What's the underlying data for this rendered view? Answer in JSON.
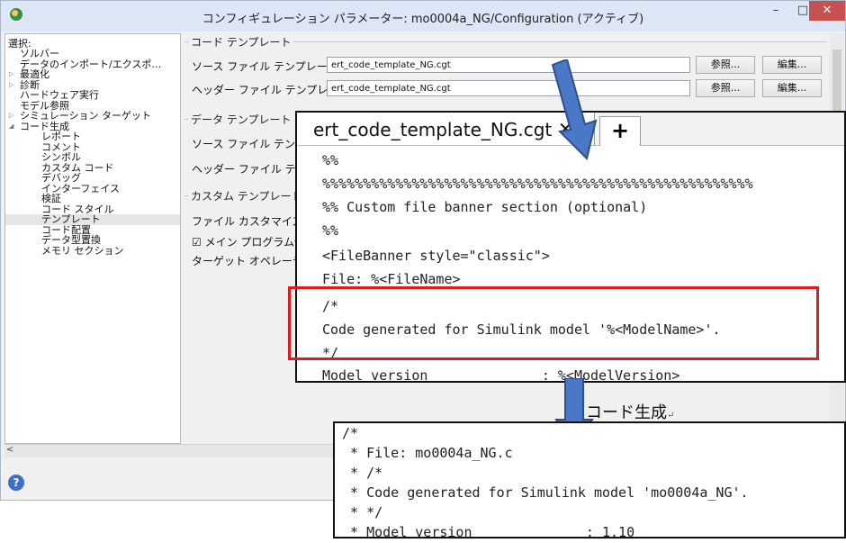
{
  "window": {
    "title": "コンフィギュレーション パラメーター: mo0004a_NG/Configuration (アクティブ)",
    "minimize": "–",
    "maximize": "□",
    "close": "✕"
  },
  "tree": {
    "header": "選択:",
    "items": [
      "ソルバー",
      "データのインポート/エクスポ…",
      "最適化",
      "診断",
      "ハードウェア実行",
      "モデル参照",
      "シミュレーション ターゲット",
      "コード生成",
      "レポート",
      "コメント",
      "シンボル",
      "カスタム コード",
      "デバッグ",
      "インターフェイス",
      "検証",
      "コード スタイル",
      "テンプレート",
      "コード配置",
      "データ型置換",
      "メモリ セクション"
    ]
  },
  "panel": {
    "code_template_section": "コード テンプレート",
    "source_template_label": "ソース ファイル テンプレート:",
    "source_template_value": "ert_code_template_NG.cgt",
    "header_template_label": "ヘッダー ファイル テンプレート:",
    "header_template_value": "ert_code_template_NG.cgt",
    "browse_label": "参照...",
    "edit_label": "編集...",
    "data_template_section": "データ テンプレート",
    "data_source_label": "ソース ファイル テンプレ",
    "data_header_label": "ヘッダー ファイル テンプレ",
    "custom_template_section": "カスタム テンプレート",
    "file_customize_label": "ファイル カスタマイズ テン",
    "main_program_label": "☑ メイン プログラム例の",
    "target_os_label": "ターゲット オペレーティン"
  },
  "editor": {
    "tab_title": "ert_code_template_NG.cgt",
    "tab_close": "✕",
    "tab_plus": "+",
    "lines": [
      "%%",
      "%%%%%%%%%%%%%%%%%%%%%%%%%%%%%%%%%%%%%%%%%%%%%%%%%%%%%",
      "%% Custom file banner section (optional)",
      "%%",
      "<FileBanner style=\"classic\">",
      "File: %<FileName>",
      "/*",
      "Code generated for Simulink model '%<ModelName>'.",
      "*/",
      "Model version              : %<ModelVersion>"
    ]
  },
  "annotation": {
    "generate_label": "コード生成",
    "return_mark": "↵"
  },
  "output": {
    "lines": [
      "/*",
      " * File: mo0004a_NG.c",
      " * /*",
      " * Code generated for Simulink model 'mo0004a_NG'.",
      " * */",
      " * Model version              : 1.10"
    ]
  },
  "colors": {
    "arrow": "#4a78c6",
    "highlight": "#e01b1b",
    "title_bar": "#dce6f4",
    "close_button": "#c75050"
  }
}
